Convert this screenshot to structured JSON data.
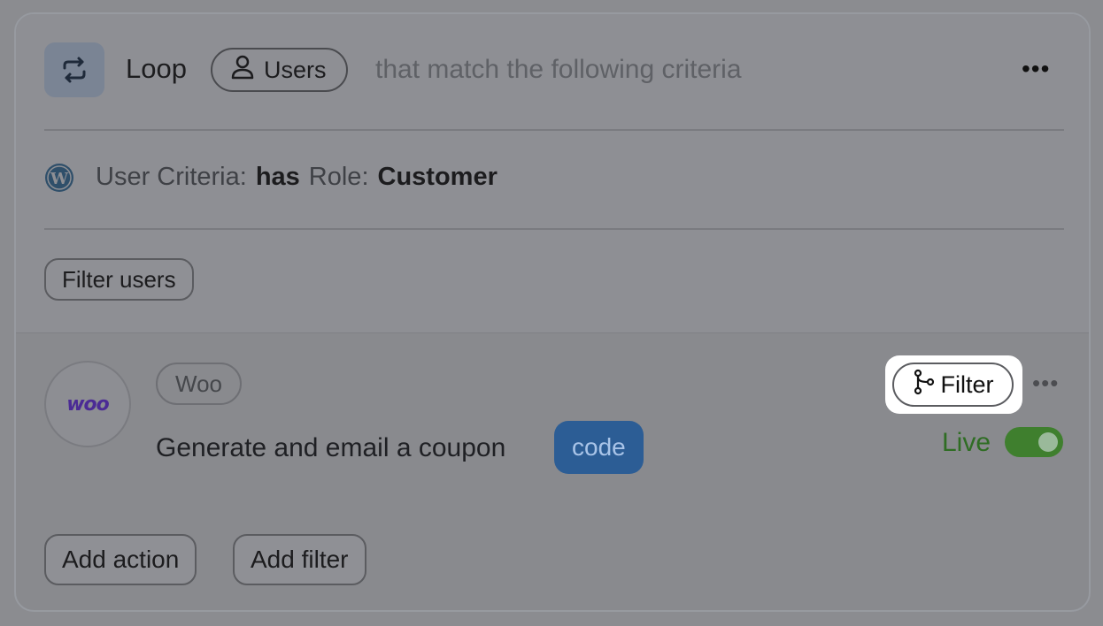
{
  "loop": {
    "label": "Loop",
    "subject": "Users",
    "criteria_text": "that match the following criteria"
  },
  "criteria": {
    "prefix": "User Criteria:",
    "operator": "has",
    "field": "Role:",
    "value": "Customer"
  },
  "buttons": {
    "filter_users": "Filter users",
    "add_action": "Add action",
    "add_filter": "Add filter"
  },
  "action": {
    "integration": "Woo",
    "logo_text": "woo",
    "description": "Generate and email a coupon",
    "token": "code",
    "filter_label": "Filter",
    "status": "Live",
    "live_enabled": true
  },
  "colors": {
    "token_bg": "#2c5d95",
    "live_green": "#3f7f2e",
    "woo_purple": "#4b2b95"
  },
  "icons": {
    "loop": "loop-icon",
    "user": "user-icon",
    "wordpress": "wordpress-icon",
    "filter": "branch-filter-icon",
    "more": "ellipsis-icon"
  }
}
